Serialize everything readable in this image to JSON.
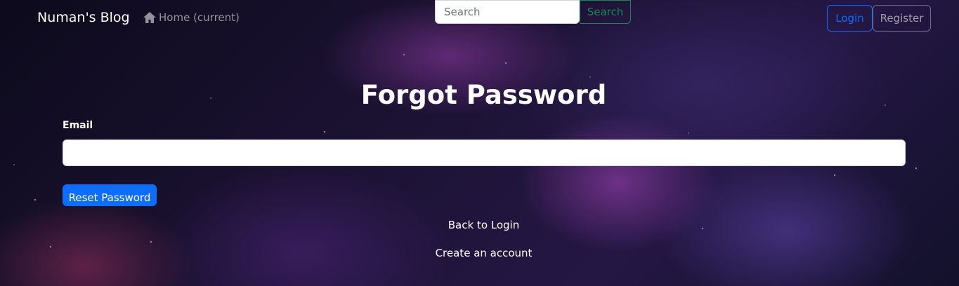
{
  "navbar": {
    "brand": "Numan's Blog",
    "home_label": "Home (current)",
    "home_icon": "home-icon",
    "search": {
      "placeholder": "Search",
      "value": "",
      "button_label": "Search",
      "button_color": "#198754"
    },
    "login_label": "Login",
    "register_label": "Register",
    "login_color": "#0d6efd"
  },
  "form": {
    "title": "Forgot Password",
    "email_label": "Email",
    "email_value": "",
    "submit_label": "Reset Password",
    "submit_color": "#0d6efd"
  },
  "links": {
    "back_to_login": "Back to Login",
    "create_account": "Create an account"
  }
}
